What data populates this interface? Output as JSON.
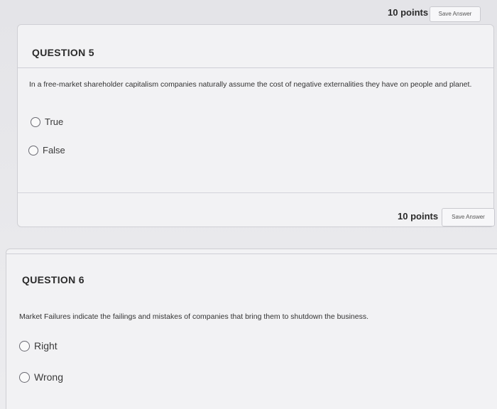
{
  "previous_footer": {
    "points": "10 points",
    "save_label": "Save Answer"
  },
  "question5": {
    "title": "QUESTION 5",
    "text": "In a free-market shareholder capitalism companies naturally assume the cost of negative externalities they have on people and planet.",
    "options": [
      {
        "label": "True"
      },
      {
        "label": "False"
      }
    ],
    "points": "10 points",
    "save_label": "Save Answer"
  },
  "question6": {
    "title": "QUESTION 6",
    "text": "Market Failures indicate the failings and mistakes of companies that bring them to shutdown the business.",
    "options": [
      {
        "label": "Right"
      },
      {
        "label": "Wrong"
      }
    ]
  }
}
